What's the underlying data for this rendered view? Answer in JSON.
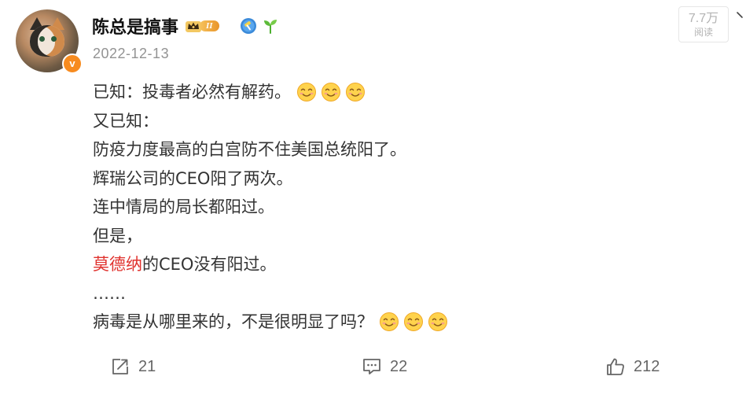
{
  "user": {
    "name": "陈总是搞事",
    "vip_level": "II",
    "verified_symbol": "v"
  },
  "post": {
    "date": "2022-12-13",
    "read_count": "7.7万",
    "read_label": "阅读",
    "lines": [
      {
        "text": "已知：投毒者必然有解药。",
        "emojis": 3
      },
      {
        "text": "又已知："
      },
      {
        "text": "防疫力度最高的白宫防不住美国总统阳了。"
      },
      {
        "text": "辉瑞公司的CEO阳了两次。"
      },
      {
        "text": "连中情局的局长都阳过。"
      },
      {
        "text": "但是，"
      },
      {
        "link": "莫德纳",
        "text": "的CEO没有阳过。"
      },
      {
        "text": "……"
      },
      {
        "text": "病毒是从哪里来的，不是很明显了吗？",
        "emojis": 3
      }
    ]
  },
  "actions": {
    "share_count": "21",
    "comment_count": "22",
    "like_count": "212"
  },
  "icons": {
    "avatar": "cat-avatar",
    "crown": "crown-icon",
    "hammer": "hammer-badge-icon",
    "sprout": "sprout-icon",
    "emoji": "smile-emoji-icon",
    "share": "share-icon",
    "comment": "comment-icon",
    "like": "thumbs-up-icon",
    "more": "chevron-down-icon"
  },
  "colors": {
    "text": "#333333",
    "link": "#e0322e",
    "muted": "#939393",
    "verify": "#f78b1f"
  }
}
